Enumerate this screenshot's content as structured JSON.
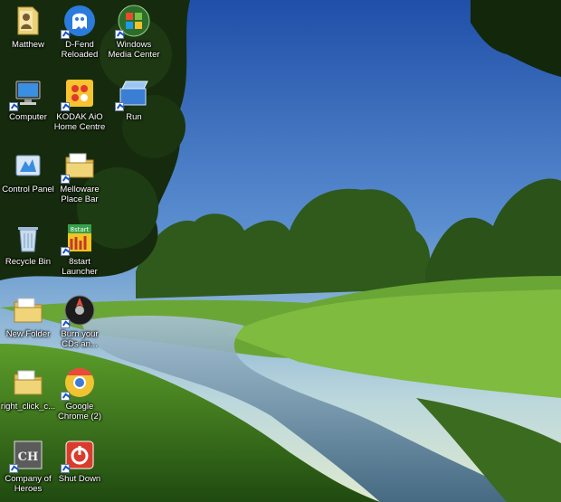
{
  "desktop": {
    "icons": [
      {
        "id": "matthew",
        "label": "Matthew",
        "icon": "user-folder-icon"
      },
      {
        "id": "dfend",
        "label": "D-Fend\nReloaded",
        "icon": "dfend-ghost-icon"
      },
      {
        "id": "wmc",
        "label": "Windows\nMedia Center",
        "icon": "windows-orb-icon"
      },
      {
        "id": "computer",
        "label": "Computer",
        "icon": "computer-icon"
      },
      {
        "id": "kodak",
        "label": "KODAK AiO\nHome Centre",
        "icon": "kodak-icon"
      },
      {
        "id": "run",
        "label": "Run",
        "icon": "run-icon"
      },
      {
        "id": "controlpanel",
        "label": "Control Panel",
        "icon": "control-panel-icon"
      },
      {
        "id": "melloware",
        "label": "Melloware\nPlace Bar",
        "icon": "folder-icon"
      },
      {
        "id": "recycle",
        "label": "Recycle Bin",
        "icon": "recycle-bin-icon"
      },
      {
        "id": "8start",
        "label": "8start\nLauncher",
        "icon": "8start-icon"
      },
      {
        "id": "newfolder",
        "label": "New Folder",
        "icon": "folder-icon"
      },
      {
        "id": "burn",
        "label": "Burn your\nCDs an...",
        "icon": "burn-disc-icon"
      },
      {
        "id": "rightclick",
        "label": "right_click_c...",
        "icon": "folder-icon"
      },
      {
        "id": "chrome",
        "label": "Google\nChrome (2)",
        "icon": "chrome-icon"
      },
      {
        "id": "coh",
        "label": "Company of\nHeroes",
        "icon": "company-of-heroes-icon"
      },
      {
        "id": "shutdown",
        "label": "Shut Down",
        "icon": "power-icon"
      }
    ]
  }
}
